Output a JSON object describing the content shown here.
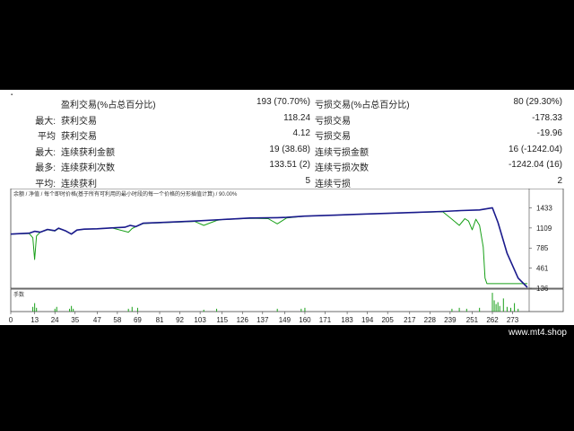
{
  "window": {
    "brand": "www.mt4.shop"
  },
  "stats": {
    "rows": [
      {
        "c1": "",
        "c2": "盈利交易(%占总百分比)",
        "c3": "193 (70.70%)",
        "c4": "亏损交易(%占总百分比)",
        "c5": "80 (29.30%)"
      },
      {
        "c1": "最大:",
        "c2": "获利交易",
        "c3": "118.24",
        "c4": "亏损交易",
        "c5": "-178.33"
      },
      {
        "c1": "平均",
        "c2": "获利交易",
        "c3": "4.12",
        "c4": "亏损交易",
        "c5": "-19.96"
      },
      {
        "c1": "最大:",
        "c2": "连续获利金额",
        "c3": "19 (38.68)",
        "c4": "连续亏损金额",
        "c5": "16 (-1242.04)"
      },
      {
        "c1": "最多:",
        "c2": "连续获利次数",
        "c3": "133.51 (2)",
        "c4": "连续亏损次数",
        "c5": "-1242.04 (16)"
      },
      {
        "c1": "平均:",
        "c2": "连续获利",
        "c3": "5",
        "c4": "连续亏损",
        "c5": "2"
      }
    ]
  },
  "chart_data": {
    "type": "line",
    "title": "余额 / 净值 / 每个即时价格(基于所有可利用的最小时段的每一个价格的分形插值计算) / 90.00%",
    "legend": [
      "余额",
      "净值"
    ],
    "volume_label": "手数",
    "x_ticks": [
      0,
      13,
      24,
      35,
      47,
      58,
      69,
      81,
      92,
      103,
      115,
      126,
      137,
      149,
      160,
      171,
      183,
      194,
      205,
      217,
      228,
      239,
      251,
      262,
      273
    ],
    "y_ticks": [
      1433,
      1109,
      785,
      461,
      136
    ],
    "ylim": [
      136,
      1600
    ],
    "xlim": [
      0,
      282
    ],
    "colors": {
      "balance": "#1a1a8c",
      "equity": "#18a018",
      "volume": "#18a018"
    },
    "series": [
      {
        "name": "余额",
        "x": [
          0,
          10,
          13,
          16,
          20,
          24,
          26,
          30,
          33,
          36,
          40,
          47,
          55,
          62,
          65,
          68,
          72,
          80,
          100,
          115,
          130,
          145,
          150,
          160,
          175,
          190,
          205,
          220,
          235,
          245,
          255,
          262,
          265,
          270,
          276,
          281
        ],
        "y": [
          1010,
          1025,
          1055,
          1040,
          1085,
          1065,
          1105,
          1060,
          1010,
          1075,
          1090,
          1095,
          1110,
          1120,
          1150,
          1130,
          1185,
          1195,
          1220,
          1245,
          1270,
          1275,
          1280,
          1300,
          1315,
          1330,
          1345,
          1360,
          1375,
          1390,
          1400,
          1435,
          1200,
          700,
          300,
          150
        ]
      },
      {
        "name": "净值",
        "x": [
          0,
          10,
          12,
          13,
          14,
          16,
          20,
          24,
          26,
          30,
          33,
          36,
          40,
          47,
          55,
          64,
          66,
          68,
          72,
          80,
          100,
          105,
          112,
          115,
          130,
          140,
          145,
          150,
          160,
          175,
          190,
          205,
          220,
          235,
          240,
          244,
          247,
          249,
          251,
          253,
          255,
          257,
          258,
          259,
          281
        ],
        "y": [
          1010,
          1020,
          950,
          600,
          980,
          1040,
          1080,
          1060,
          1100,
          1060,
          1010,
          1075,
          1090,
          1095,
          1110,
          1040,
          1100,
          1130,
          1180,
          1190,
          1215,
          1150,
          1230,
          1245,
          1265,
          1260,
          1175,
          1270,
          1300,
          1315,
          1330,
          1345,
          1360,
          1370,
          1250,
          1150,
          1260,
          1220,
          1080,
          1250,
          1150,
          800,
          300,
          210,
          210
        ]
      }
    ],
    "volume_bars": [
      {
        "x": 12,
        "v": 5
      },
      {
        "x": 13,
        "v": 9
      },
      {
        "x": 14,
        "v": 4
      },
      {
        "x": 24,
        "v": 3
      },
      {
        "x": 25,
        "v": 5
      },
      {
        "x": 32,
        "v": 3
      },
      {
        "x": 33,
        "v": 6
      },
      {
        "x": 34,
        "v": 3
      },
      {
        "x": 64,
        "v": 3
      },
      {
        "x": 66,
        "v": 5
      },
      {
        "x": 69,
        "v": 4
      },
      {
        "x": 105,
        "v": 2
      },
      {
        "x": 112,
        "v": 3
      },
      {
        "x": 145,
        "v": 3
      },
      {
        "x": 158,
        "v": 3
      },
      {
        "x": 160,
        "v": 4
      },
      {
        "x": 240,
        "v": 3
      },
      {
        "x": 244,
        "v": 4
      },
      {
        "x": 248,
        "v": 3
      },
      {
        "x": 255,
        "v": 4
      },
      {
        "x": 262,
        "v": 20
      },
      {
        "x": 263,
        "v": 12
      },
      {
        "x": 264,
        "v": 8
      },
      {
        "x": 265,
        "v": 10
      },
      {
        "x": 266,
        "v": 6
      },
      {
        "x": 268,
        "v": 14
      },
      {
        "x": 270,
        "v": 5
      },
      {
        "x": 272,
        "v": 4
      },
      {
        "x": 274,
        "v": 9
      },
      {
        "x": 276,
        "v": 3
      }
    ]
  }
}
